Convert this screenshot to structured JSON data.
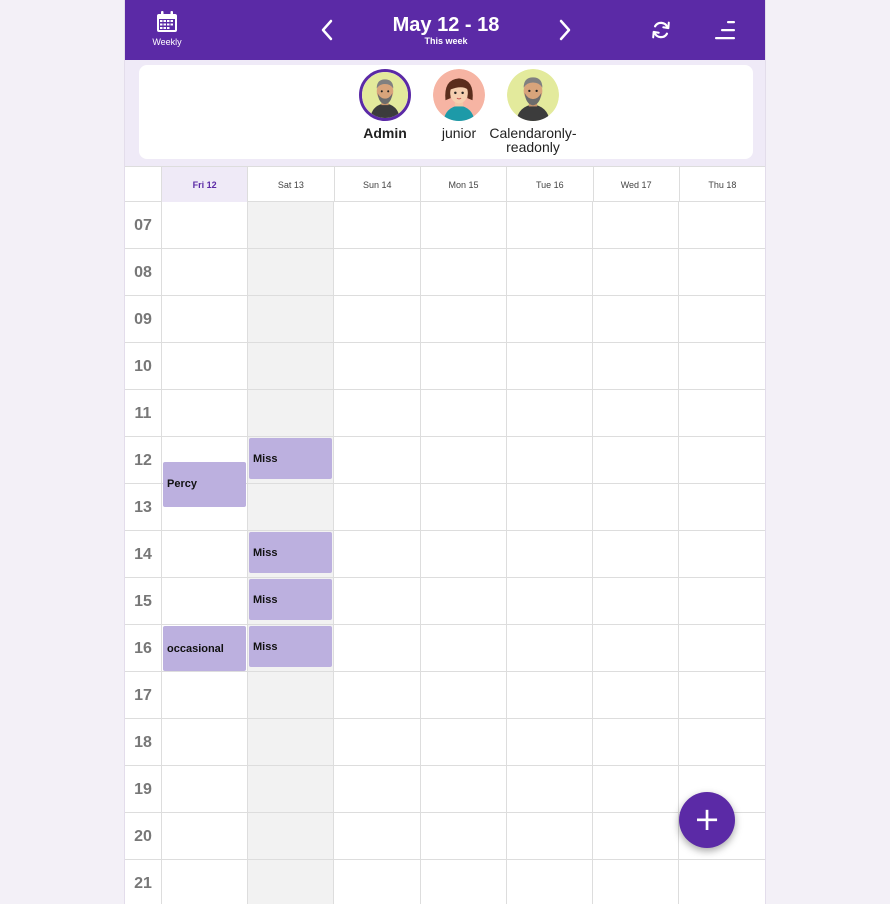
{
  "header": {
    "view_label": "Weekly",
    "week_title": "May 12 - 18",
    "week_subtitle": "This week",
    "accent_color": "#5b2aa6"
  },
  "users": [
    {
      "name": "Admin",
      "selected": true,
      "avatar": "man-gray-beard-avatar"
    },
    {
      "name": "junior",
      "selected": false,
      "avatar": "girl-brown-hair-avatar"
    },
    {
      "name": "Calendaronly-readonly",
      "selected": false,
      "avatar": "man-gray-beard-avatar"
    }
  ],
  "days": [
    "Fri 12",
    "Sat 13",
    "Sun 14",
    "Mon 15",
    "Tue 16",
    "Wed 17",
    "Thu 18"
  ],
  "hours": [
    "07",
    "08",
    "09",
    "10",
    "11",
    "12",
    "13",
    "14",
    "15",
    "16",
    "17",
    "18",
    "19",
    "20",
    "21"
  ],
  "events": [
    {
      "title": "Percy",
      "day": 0,
      "start": "12:30",
      "end": "13:30"
    },
    {
      "title": "occasional",
      "day": 0,
      "start": "16:00",
      "end": "17:00"
    },
    {
      "title": "Miss",
      "day": 1,
      "start": "12:00",
      "end": "12:55"
    },
    {
      "title": "Miss",
      "day": 1,
      "start": "14:00",
      "end": "14:55"
    },
    {
      "title": "Miss",
      "day": 1,
      "start": "15:00",
      "end": "15:55"
    },
    {
      "title": "Miss",
      "day": 1,
      "start": "16:00",
      "end": "16:55"
    }
  ],
  "event_color": "#bcb0df",
  "fab_label": "+"
}
